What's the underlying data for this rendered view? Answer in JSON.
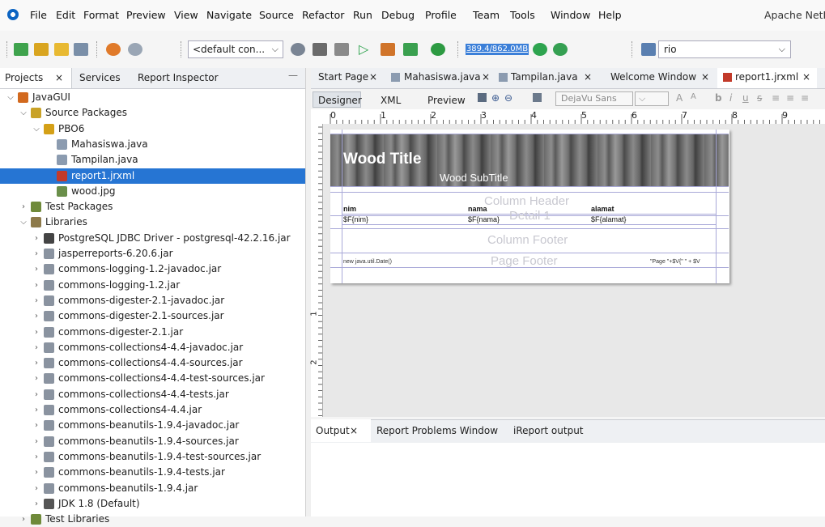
{
  "menubar": {
    "items": [
      "File",
      "Edit",
      "Format",
      "Preview",
      "View",
      "Navigate",
      "Source",
      "Refactor",
      "Run",
      "Debug",
      "Profile",
      "Team",
      "Tools",
      "Window",
      "Help"
    ],
    "app_title": "Apache NetB"
  },
  "toolbar": {
    "config": "<default con...",
    "memory": "389.4/862.0MB",
    "search_value": "rio"
  },
  "left_panel": {
    "tabs": [
      "Projects",
      "Services",
      "Report Inspector"
    ],
    "tree": [
      {
        "label": "JavaGUI",
        "depth": 0,
        "toggle": "open",
        "icon": "project"
      },
      {
        "label": "Source Packages",
        "depth": 1,
        "toggle": "open",
        "icon": "source-folder"
      },
      {
        "label": "PBO6",
        "depth": 2,
        "toggle": "open",
        "icon": "package"
      },
      {
        "label": "Mahasiswa.java",
        "depth": 3,
        "toggle": "",
        "icon": "java-form"
      },
      {
        "label": "Tampilan.java",
        "depth": 3,
        "toggle": "",
        "icon": "java-form"
      },
      {
        "label": "report1.jrxml",
        "depth": 3,
        "toggle": "",
        "icon": "jasper",
        "selected": true
      },
      {
        "label": "wood.jpg",
        "depth": 3,
        "toggle": "",
        "icon": "image"
      },
      {
        "label": "Test Packages",
        "depth": 1,
        "toggle": "closed",
        "icon": "test-folder"
      },
      {
        "label": "Libraries",
        "depth": 1,
        "toggle": "open",
        "icon": "libraries"
      },
      {
        "label": "PostgreSQL JDBC Driver - postgresql-42.2.16.jar",
        "depth": 2,
        "toggle": "closed",
        "icon": "driver"
      },
      {
        "label": "jasperreports-6.20.6.jar",
        "depth": 2,
        "toggle": "closed",
        "icon": "jar"
      },
      {
        "label": "commons-logging-1.2-javadoc.jar",
        "depth": 2,
        "toggle": "closed",
        "icon": "jar"
      },
      {
        "label": "commons-logging-1.2.jar",
        "depth": 2,
        "toggle": "closed",
        "icon": "jar"
      },
      {
        "label": "commons-digester-2.1-javadoc.jar",
        "depth": 2,
        "toggle": "closed",
        "icon": "jar"
      },
      {
        "label": "commons-digester-2.1-sources.jar",
        "depth": 2,
        "toggle": "closed",
        "icon": "jar"
      },
      {
        "label": "commons-digester-2.1.jar",
        "depth": 2,
        "toggle": "closed",
        "icon": "jar"
      },
      {
        "label": "commons-collections4-4.4-javadoc.jar",
        "depth": 2,
        "toggle": "closed",
        "icon": "jar"
      },
      {
        "label": "commons-collections4-4.4-sources.jar",
        "depth": 2,
        "toggle": "closed",
        "icon": "jar"
      },
      {
        "label": "commons-collections4-4.4-test-sources.jar",
        "depth": 2,
        "toggle": "closed",
        "icon": "jar"
      },
      {
        "label": "commons-collections4-4.4-tests.jar",
        "depth": 2,
        "toggle": "closed",
        "icon": "jar"
      },
      {
        "label": "commons-collections4-4.4.jar",
        "depth": 2,
        "toggle": "closed",
        "icon": "jar"
      },
      {
        "label": "commons-beanutils-1.9.4-javadoc.jar",
        "depth": 2,
        "toggle": "closed",
        "icon": "jar"
      },
      {
        "label": "commons-beanutils-1.9.4-sources.jar",
        "depth": 2,
        "toggle": "closed",
        "icon": "jar"
      },
      {
        "label": "commons-beanutils-1.9.4-test-sources.jar",
        "depth": 2,
        "toggle": "closed",
        "icon": "jar"
      },
      {
        "label": "commons-beanutils-1.9.4-tests.jar",
        "depth": 2,
        "toggle": "closed",
        "icon": "jar"
      },
      {
        "label": "commons-beanutils-1.9.4.jar",
        "depth": 2,
        "toggle": "closed",
        "icon": "jar"
      },
      {
        "label": "JDK 1.8 (Default)",
        "depth": 2,
        "toggle": "closed",
        "icon": "jdk"
      },
      {
        "label": "Test Libraries",
        "depth": 1,
        "toggle": "closed",
        "icon": "test-libraries"
      }
    ]
  },
  "editor": {
    "tabs": [
      "Start Page",
      "Mahasiswa.java",
      "Tampilan.java",
      "Welcome Window",
      "report1.jrxml"
    ],
    "designer_tabs": [
      "Designer",
      "XML",
      "Preview"
    ],
    "font": "DejaVu Sans",
    "ruler_numbers": [
      "0",
      "1",
      "2",
      "3",
      "4",
      "5",
      "6",
      "7",
      "8",
      "9"
    ],
    "vruler_numbers": [
      "1",
      "2"
    ],
    "report": {
      "title": "Wood Title",
      "subtitle": "Wood SubTitle",
      "column_header_band": "Column Header",
      "headers": [
        "nim",
        "nama",
        "alamat"
      ],
      "fields": [
        "$F{nim}",
        "$F{nama}",
        "$F{alamat}"
      ],
      "detail_band": "Detail 1",
      "column_footer_band": "Column Footer",
      "page_footer_band": "Page Footer",
      "date_expr": "new java.util.Date()",
      "page_expr": "\"Page \"+$V{\" \" + $V"
    }
  },
  "output": {
    "tabs": [
      "Output",
      "Report Problems Window",
      "iReport output"
    ]
  }
}
